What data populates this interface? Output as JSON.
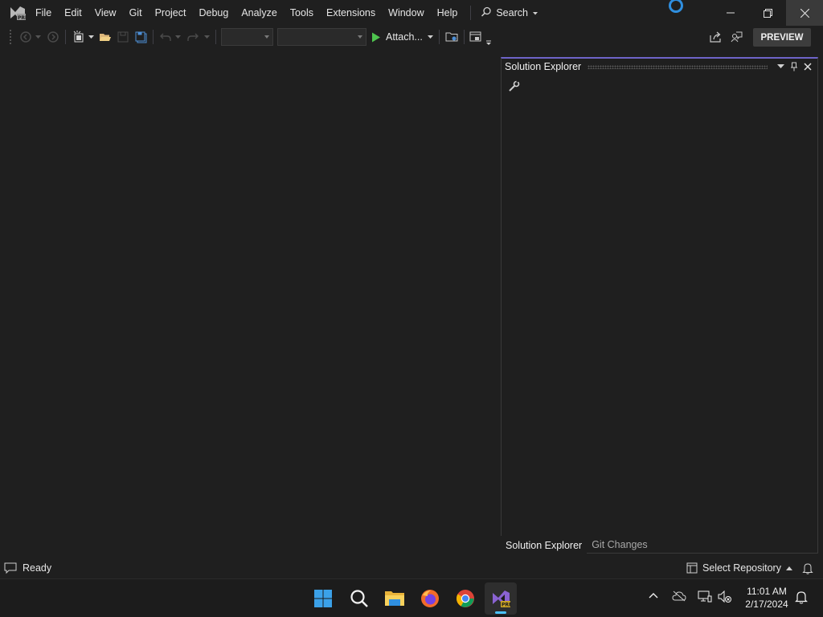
{
  "menu": {
    "items": [
      "File",
      "Edit",
      "View",
      "Git",
      "Project",
      "Debug",
      "Analyze",
      "Tools",
      "Extensions",
      "Window",
      "Help"
    ],
    "search_label": "Search"
  },
  "toolbar": {
    "attach_label": "Attach...",
    "preview_label": "PREVIEW",
    "run_color": "#4ec44e"
  },
  "solution_explorer": {
    "title": "Solution Explorer",
    "tabs": [
      "Solution Explorer",
      "Git Changes"
    ]
  },
  "status_bar": {
    "status": "Ready",
    "repo_label": "Select Repository"
  },
  "taskbar": {
    "apps": [
      "windows-start-icon",
      "search-icon",
      "file-explorer-icon",
      "firefox-icon",
      "chrome-icon",
      "visual-studio-preview-icon"
    ],
    "time": "11:01 AM",
    "date": "2/17/2024"
  },
  "colors": {
    "accent": "#6e64c8",
    "background": "#1f1f1f",
    "taskbar_indicator": "#4cc2ff"
  }
}
